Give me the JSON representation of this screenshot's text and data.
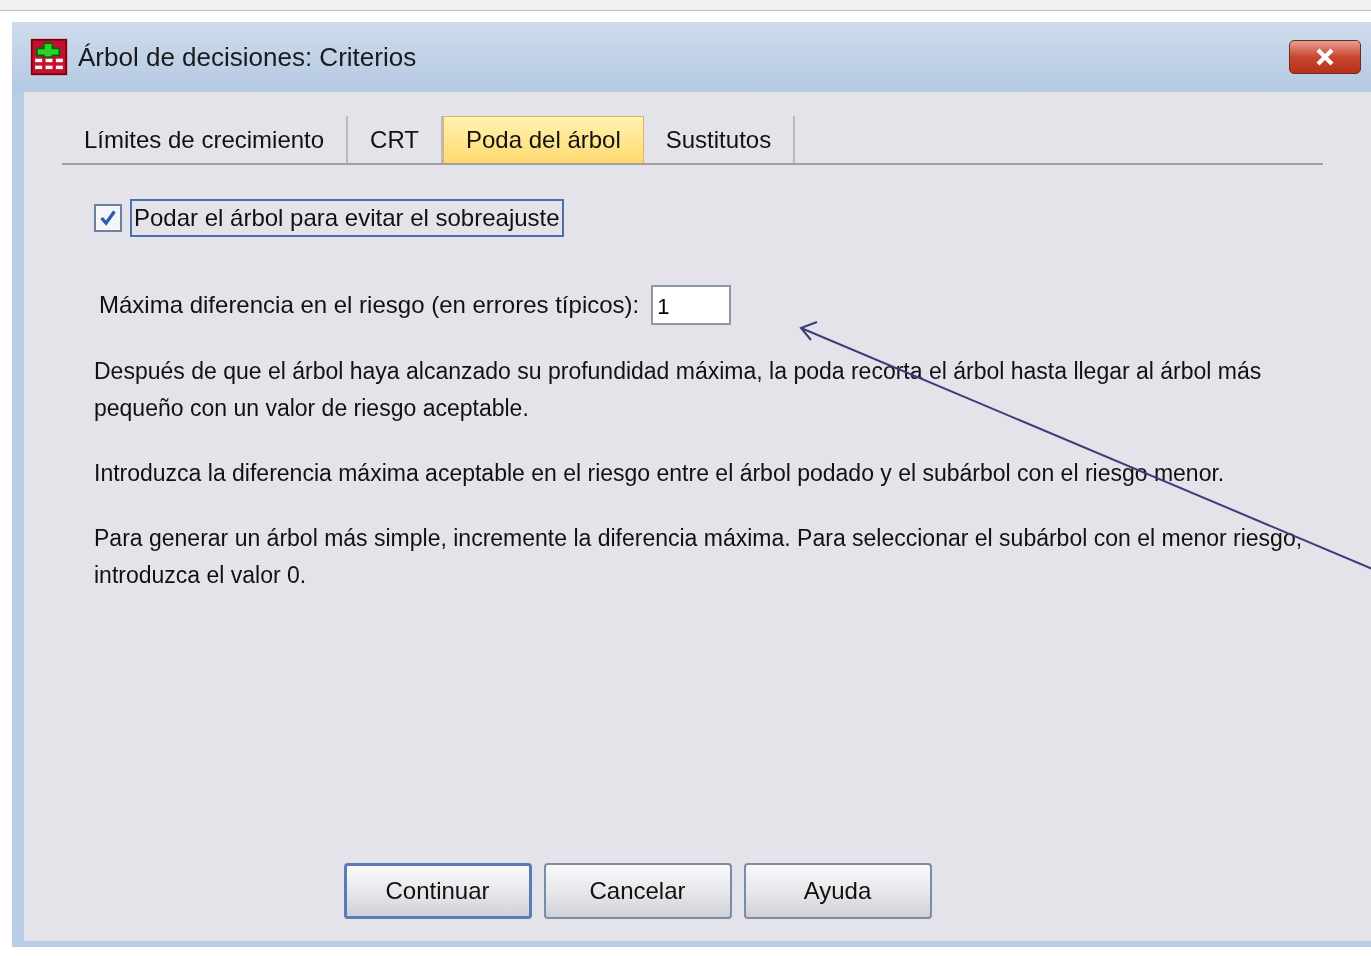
{
  "window": {
    "title": "Árbol de decisiones: Criterios"
  },
  "tabs": [
    {
      "label": "Límites de crecimiento",
      "selected": false
    },
    {
      "label": "CRT",
      "selected": false
    },
    {
      "label": "Poda del árbol",
      "selected": true
    },
    {
      "label": "Sustitutos",
      "selected": false
    }
  ],
  "prune": {
    "label": "Podar el árbol para evitar el sobreajuste",
    "checked": true
  },
  "max_risk": {
    "label": "Máxima diferencia en el riesgo (en errores típicos):",
    "value": "1"
  },
  "paragraphs": [
    "Después de que el árbol haya alcanzado su profundidad máxima, la poda recorta el árbol hasta llegar al árbol más pequeño con un valor de riesgo aceptable.",
    "Introduzca la diferencia máxima aceptable en el riesgo entre el árbol podado y el subárbol con el riesgo menor.",
    "Para generar un árbol más simple, incremente la diferencia máxima. Para seleccionar el subárbol con el menor riesgo, introduzca el valor 0."
  ],
  "buttons": [
    {
      "label": "Continuar",
      "default": true
    },
    {
      "label": "Cancelar",
      "default": false
    },
    {
      "label": "Ayuda",
      "default": false
    }
  ]
}
